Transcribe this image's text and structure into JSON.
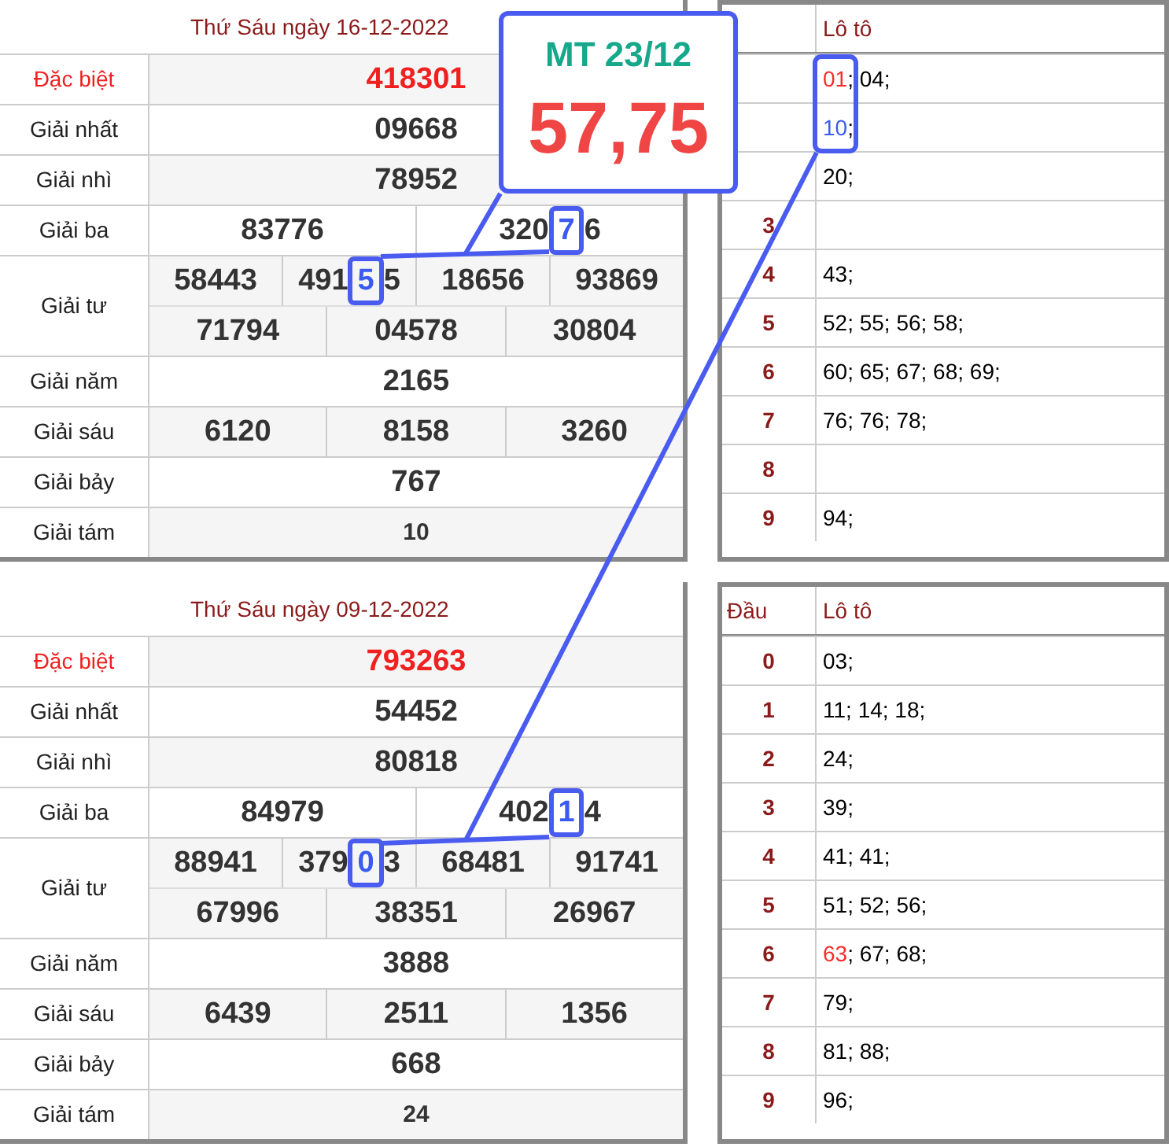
{
  "days": [
    {
      "title": "Thứ Sáu ngày 16-12-2022",
      "prizes": [
        {
          "label": "Đặc biệt",
          "kind": "special",
          "lines": [
            {
              "numbers": [
                "418301"
              ]
            }
          ]
        },
        {
          "label": "Giải nhất",
          "kind": "normal",
          "lines": [
            {
              "numbers": [
                "09668"
              ]
            }
          ]
        },
        {
          "label": "Giải nhì",
          "kind": "normal",
          "lines": [
            {
              "numbers": [
                "78952"
              ]
            }
          ]
        },
        {
          "label": "Giải ba",
          "kind": "normal",
          "lines": [
            {
              "numbers": [
                "83776",
                {
                  "before": "320",
                  "highlight": "7",
                  "after": "6"
                }
              ]
            }
          ]
        },
        {
          "label": "Giải tư",
          "kind": "normal",
          "lines": [
            {
              "numbers": [
                "58443",
                {
                  "before": "491",
                  "highlight": "5",
                  "after": "5"
                },
                "18656",
                "93869"
              ]
            },
            {
              "numbers": [
                "71794",
                "04578",
                "30804"
              ]
            }
          ]
        },
        {
          "label": "Giải năm",
          "kind": "normal",
          "lines": [
            {
              "numbers": [
                "2165"
              ]
            }
          ]
        },
        {
          "label": "Giải sáu",
          "kind": "normal",
          "lines": [
            {
              "numbers": [
                "6120",
                "8158",
                "3260"
              ]
            }
          ]
        },
        {
          "label": "Giải bảy",
          "kind": "normal",
          "lines": [
            {
              "numbers": [
                "767"
              ]
            }
          ]
        },
        {
          "label": "Giải tám",
          "kind": "eighth",
          "lines": [
            {
              "numbers": [
                "10"
              ]
            }
          ]
        }
      ],
      "loto": {
        "loto_header": "Lô tô",
        "rows": [
          {
            "lead": {
              "text": "01",
              "color": "#ff2a2a"
            },
            "rest": "; 04;"
          },
          {
            "lead": {
              "text": "10",
              "color": "#3b5bf0"
            },
            "rest": ";"
          },
          {
            "rest": "20;"
          },
          {
            "head": "3"
          },
          {
            "head": "4",
            "rest": "43;"
          },
          {
            "head": "5",
            "rest": "52; 55; 56; 58;"
          },
          {
            "head": "6",
            "rest": "60; 65; 67; 68; 69;"
          },
          {
            "head": "7",
            "rest": "76; 76; 78;"
          },
          {
            "head": "8"
          },
          {
            "head": "9",
            "rest": "94;"
          }
        ]
      }
    },
    {
      "title": "Thứ Sáu ngày 09-12-2022",
      "prizes": [
        {
          "label": "Đặc biệt",
          "kind": "special",
          "lines": [
            {
              "numbers": [
                "793263"
              ]
            }
          ]
        },
        {
          "label": "Giải nhất",
          "kind": "normal",
          "lines": [
            {
              "numbers": [
                "54452"
              ]
            }
          ]
        },
        {
          "label": "Giải nhì",
          "kind": "normal",
          "lines": [
            {
              "numbers": [
                "80818"
              ]
            }
          ]
        },
        {
          "label": "Giải ba",
          "kind": "normal",
          "lines": [
            {
              "numbers": [
                "84979",
                {
                  "before": "402",
                  "highlight": "1",
                  "after": "4"
                }
              ]
            }
          ]
        },
        {
          "label": "Giải tư",
          "kind": "normal",
          "lines": [
            {
              "numbers": [
                "88941",
                {
                  "before": "379",
                  "highlight": "0",
                  "after": "3"
                },
                "68481",
                "91741"
              ]
            },
            {
              "numbers": [
                "67996",
                "38351",
                "26967"
              ]
            }
          ]
        },
        {
          "label": "Giải năm",
          "kind": "normal",
          "lines": [
            {
              "numbers": [
                "3888"
              ]
            }
          ]
        },
        {
          "label": "Giải sáu",
          "kind": "normal",
          "lines": [
            {
              "numbers": [
                "6439",
                "2511",
                "1356"
              ]
            }
          ]
        },
        {
          "label": "Giải bảy",
          "kind": "normal",
          "lines": [
            {
              "numbers": [
                "668"
              ]
            }
          ]
        },
        {
          "label": "Giải tám",
          "kind": "eighth",
          "lines": [
            {
              "numbers": [
                "24"
              ]
            }
          ]
        }
      ],
      "loto": {
        "head_header": "Đầu",
        "loto_header": "Lô tô",
        "rows": [
          {
            "head": "0",
            "rest": "03;"
          },
          {
            "head": "1",
            "rest": "11; 14; 18;"
          },
          {
            "head": "2",
            "rest": "24;"
          },
          {
            "head": "3",
            "rest": "39;"
          },
          {
            "head": "4",
            "rest": "41; 41;"
          },
          {
            "head": "5",
            "rest": "51; 52; 56;"
          },
          {
            "head": "6",
            "lead": {
              "text": "63",
              "color": "#ff2a2a"
            },
            "rest": "; 67; 68;"
          },
          {
            "head": "7",
            "rest": "79;"
          },
          {
            "head": "8",
            "rest": "81; 88;"
          },
          {
            "head": "9",
            "rest": "96;"
          }
        ]
      }
    }
  ],
  "callout": {
    "title": "MT 23/12",
    "numbers": "57,75"
  }
}
